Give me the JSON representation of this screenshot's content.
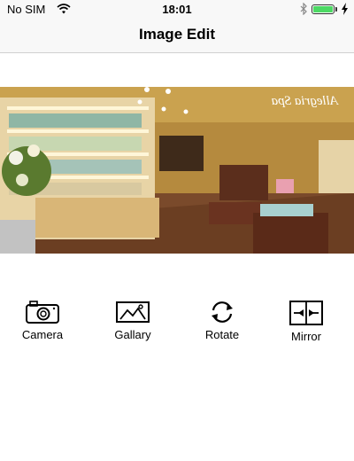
{
  "status_bar": {
    "carrier": "No SIM",
    "time": "18:01",
    "battery_level": 1.0,
    "battery_color": "#4cd964"
  },
  "nav": {
    "title": "Image Edit"
  },
  "photo": {
    "description_icon": "store-interior-photo",
    "sign_text": "Allegria Spa"
  },
  "toolbar": {
    "items": [
      {
        "label": "Camera",
        "icon": "camera-icon"
      },
      {
        "label": "Gallary",
        "icon": "gallery-icon"
      },
      {
        "label": "Rotate",
        "icon": "rotate-icon"
      },
      {
        "label": "Mirror",
        "icon": "mirror-icon"
      }
    ]
  }
}
